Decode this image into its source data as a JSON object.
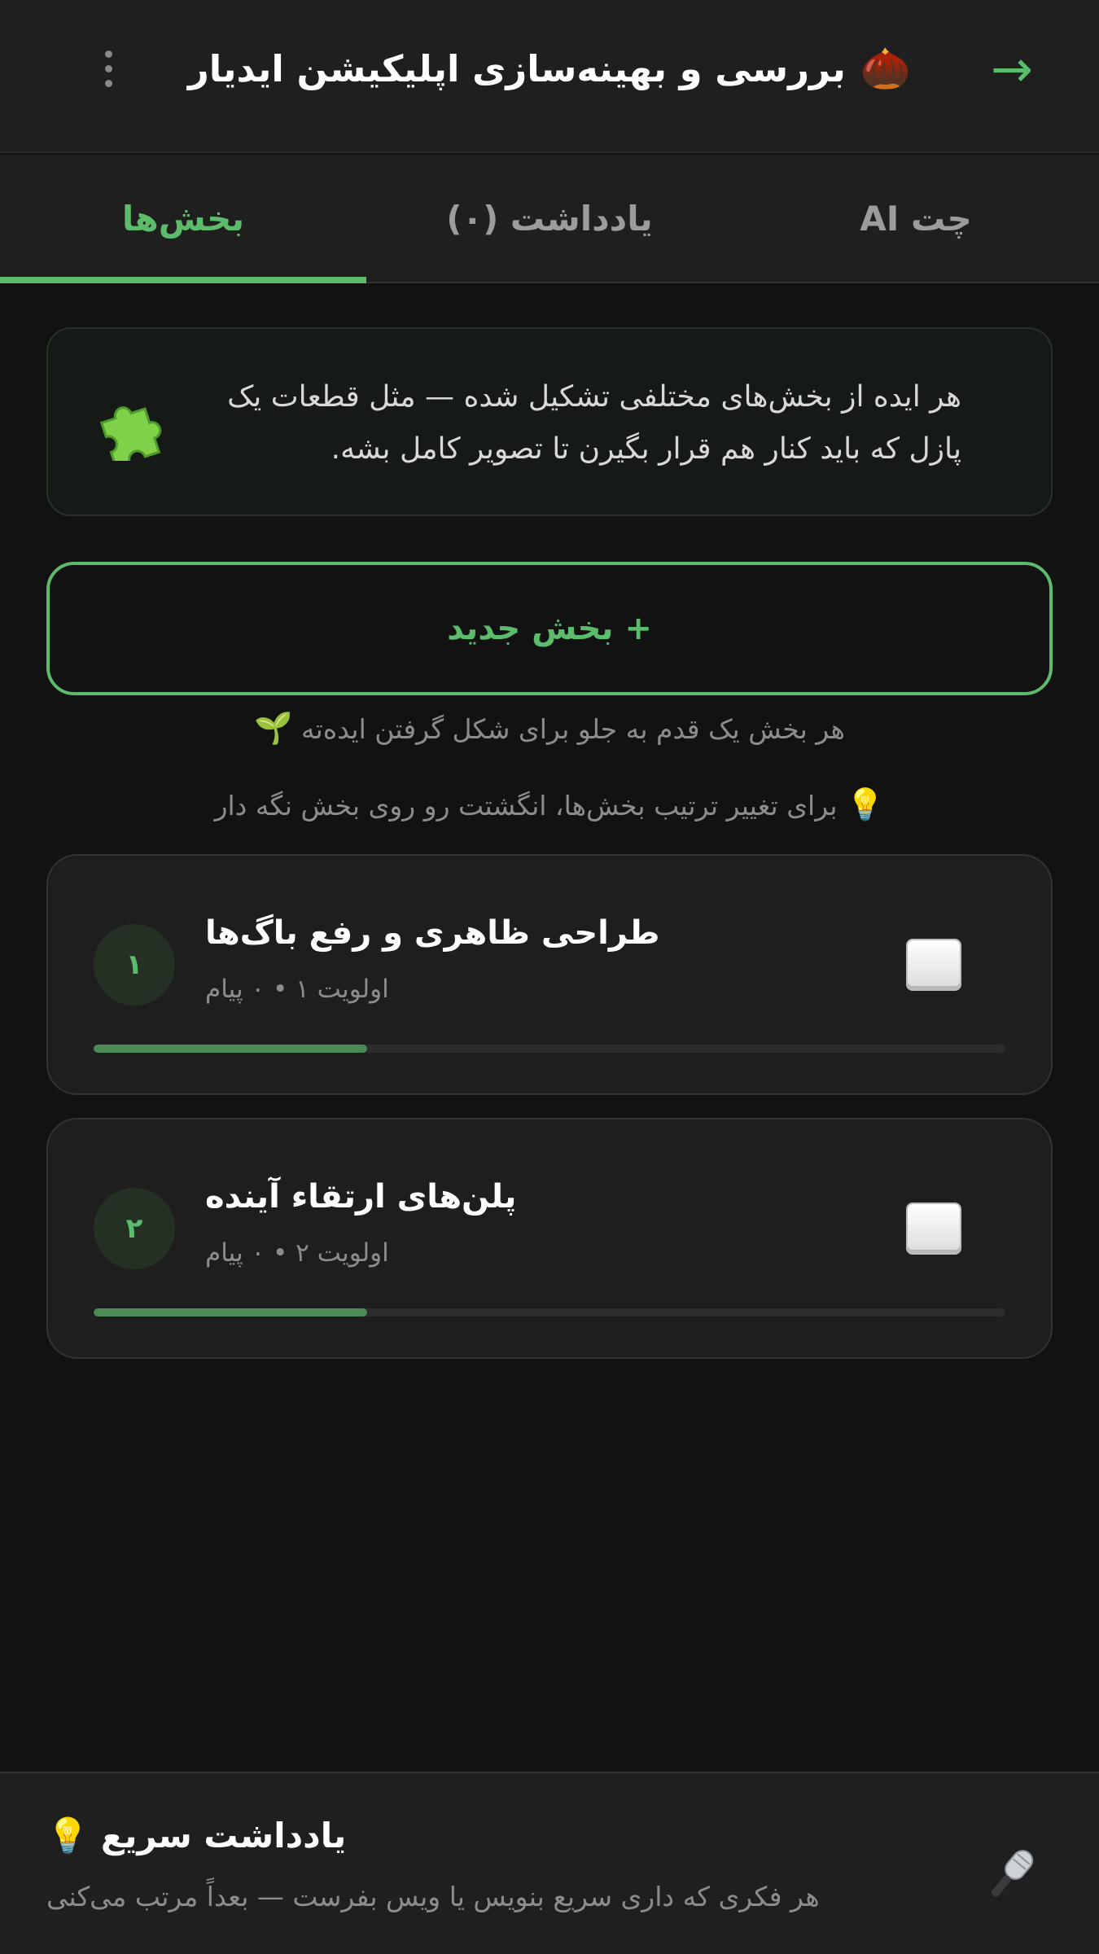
{
  "header": {
    "title": "بررسی و بهینه‌سازی اپلیکیشن ایدیار",
    "title_emoji": "🌰",
    "back_icon": "arrow-icon",
    "menu_icon": "more-vertical-icon"
  },
  "tabs": [
    {
      "label": "چت AI",
      "active": false
    },
    {
      "label": "یادداشت (۰)",
      "active": false
    },
    {
      "label": "بخش‌ها",
      "active": true
    }
  ],
  "info_card": {
    "text": "هر ایده از بخش‌های مختلفی تشکیل شده — مثل قطعات یک پازل که باید کنار هم قرار بگیرن تا تصویر کامل بشه.",
    "icon": "puzzle-icon"
  },
  "new_section_button": "+ بخش جدید",
  "hint_progress": "هر بخش یک قدم به جلو برای شکل گرفتن ایده‌ته",
  "hint_progress_emoji": "🌱",
  "hint_reorder": "برای تغییر ترتیب بخش‌ها، انگشتت رو روی بخش نگه دار",
  "hint_reorder_emoji": "💡",
  "sections": [
    {
      "number": "۱",
      "title": "طراحی ظاهری و رفع باگ‌ها",
      "meta": "اولویت ۱ • ۰ پیام",
      "progress": 0.3
    },
    {
      "number": "۲",
      "title": "پلن‌های ارتقاء آینده",
      "meta": "اولویت ۲ • ۰ پیام",
      "progress": 0.3
    }
  ],
  "quick_note": {
    "title": "یادداشت سریع",
    "title_emoji": "💡",
    "subtitle": "هر فکری که داری سریع بنویس یا ویس بفرست — بعداً مرتب می‌کنی",
    "mic_icon": "microphone-icon"
  },
  "colors": {
    "accent": "#5cbc6c",
    "background": "#121212",
    "surface": "#1f1f1f"
  }
}
